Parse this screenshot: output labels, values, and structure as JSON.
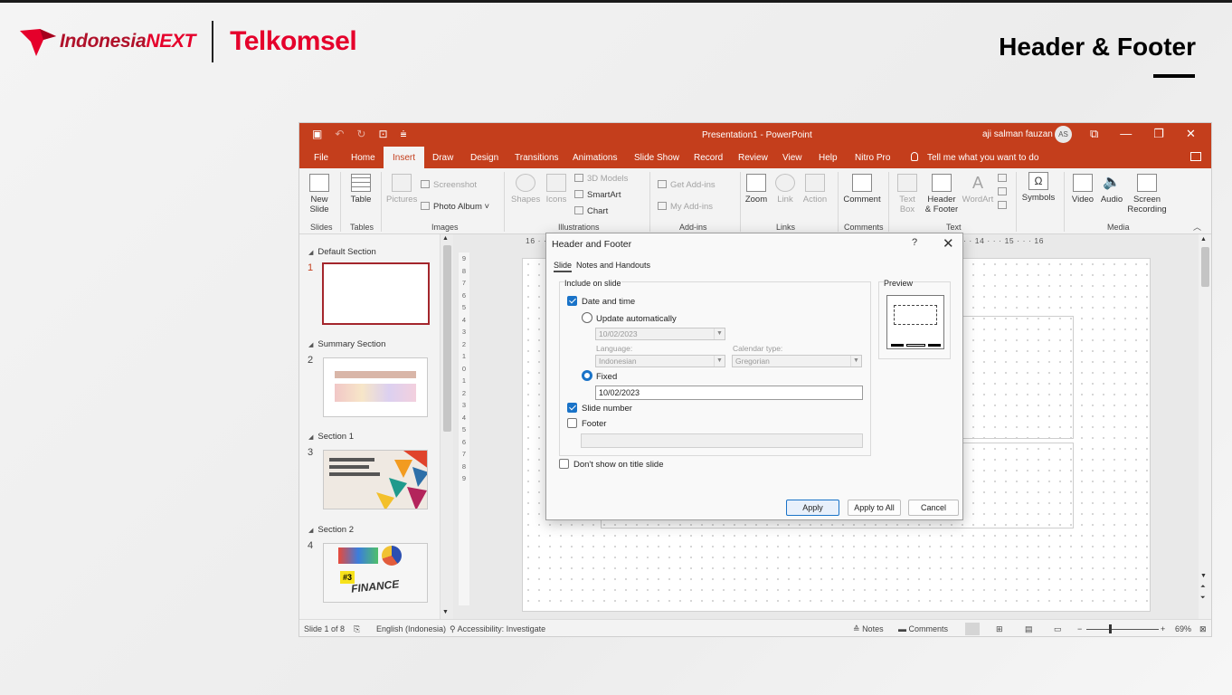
{
  "brand": {
    "name1": "Indonesia",
    "name1_next": "NEXT",
    "name2": "Telkomsel",
    "accent": "#e5002b"
  },
  "page_title": "Header & Footer",
  "window": {
    "document_title": "Presentation1  -  PowerPoint",
    "user_name": "aji salman fauzan",
    "user_initials": "AS",
    "accent": "#c43e1c"
  },
  "tabs": [
    "File",
    "Home",
    "Insert",
    "Draw",
    "Design",
    "Transitions",
    "Animations",
    "Slide Show",
    "Record",
    "Review",
    "View",
    "Help",
    "Nitro Pro"
  ],
  "active_tab": "Insert",
  "tell_me": "Tell me what you want to do",
  "ribbon": {
    "new_slide": "New\nSlide",
    "new_slide_l1": "New",
    "new_slide_l2": "Slide",
    "table": "Table",
    "pictures": "Pictures",
    "screenshot": "Screenshot",
    "photo_album": "Photo Album",
    "shapes": "Shapes",
    "icons": "Icons",
    "models_3d": "3D Models",
    "smartart": "SmartArt",
    "chart": "Chart",
    "get_addins": "Get Add-ins",
    "my_addins": "My Add-ins",
    "zoom": "Zoom",
    "link": "Link",
    "action": "Action",
    "comment": "Comment",
    "text_box_l1": "Text",
    "text_box_l2": "Box",
    "header_footer_l1": "Header",
    "header_footer_l2": "& Footer",
    "wordart": "WordArt",
    "symbols": "Symbols",
    "video": "Video",
    "audio": "Audio",
    "screen_recording_l1": "Screen",
    "screen_recording_l2": "Recording",
    "groups": {
      "slides": "Slides",
      "tables": "Tables",
      "images": "Images",
      "illustrations": "Illustrations",
      "addins": "Add-ins",
      "links": "Links",
      "comments": "Comments",
      "text": "Text",
      "media": "Media"
    }
  },
  "thumbnails": {
    "sections": [
      "Default Section",
      "Summary Section",
      "Section 1",
      "Section 2"
    ],
    "slide_numbers": [
      "1",
      "2",
      "3",
      "4"
    ],
    "slide4_label": "FINANCE",
    "slide4_badge": "#3"
  },
  "ruler": {
    "horizontal": "16 · · · 15 · · · 14 · · · 13 · · · 12 · · · 11 · · · 10 · · · 9 · · · 8 · · · 7 · · · 8 · · · 9 · · · 10 · · · 11 · · · 12 · · · 13 · · · 14 · · · 15 · · · 16",
    "vertical": "9 8 7 6 5 4 3 2 1 0 1 2 3 4 5 6 7 8 9"
  },
  "status": {
    "slide_of": "Slide 1 of 8",
    "language": "English (Indonesia)",
    "accessibility": "Accessibility: Investigate",
    "notes": "Notes",
    "comments": "Comments",
    "zoom": "69%"
  },
  "dialog": {
    "title": "Header and Footer",
    "help": "?",
    "close": "✕",
    "tabs": [
      "Slide",
      "Notes and Handouts"
    ],
    "active_tab": "Slide",
    "include_on_slide": "Include on slide",
    "date_and_time": "Date and time",
    "date_and_time_checked": true,
    "update_automatically": "Update automatically",
    "auto_date": "10/02/2023",
    "language_label": "Language:",
    "language_value": "Indonesian",
    "calendar_label": "Calendar type:",
    "calendar_value": "Gregorian",
    "fixed": "Fixed",
    "fixed_value": "10/02/2023",
    "slide_number": "Slide number",
    "slide_number_checked": true,
    "footer": "Footer",
    "footer_checked": false,
    "footer_value": "",
    "dont_show_title": "Don't show on title slide",
    "dont_show_checked": false,
    "preview": "Preview",
    "buttons": {
      "apply": "Apply",
      "apply_all": "Apply to All",
      "cancel": "Cancel"
    }
  }
}
